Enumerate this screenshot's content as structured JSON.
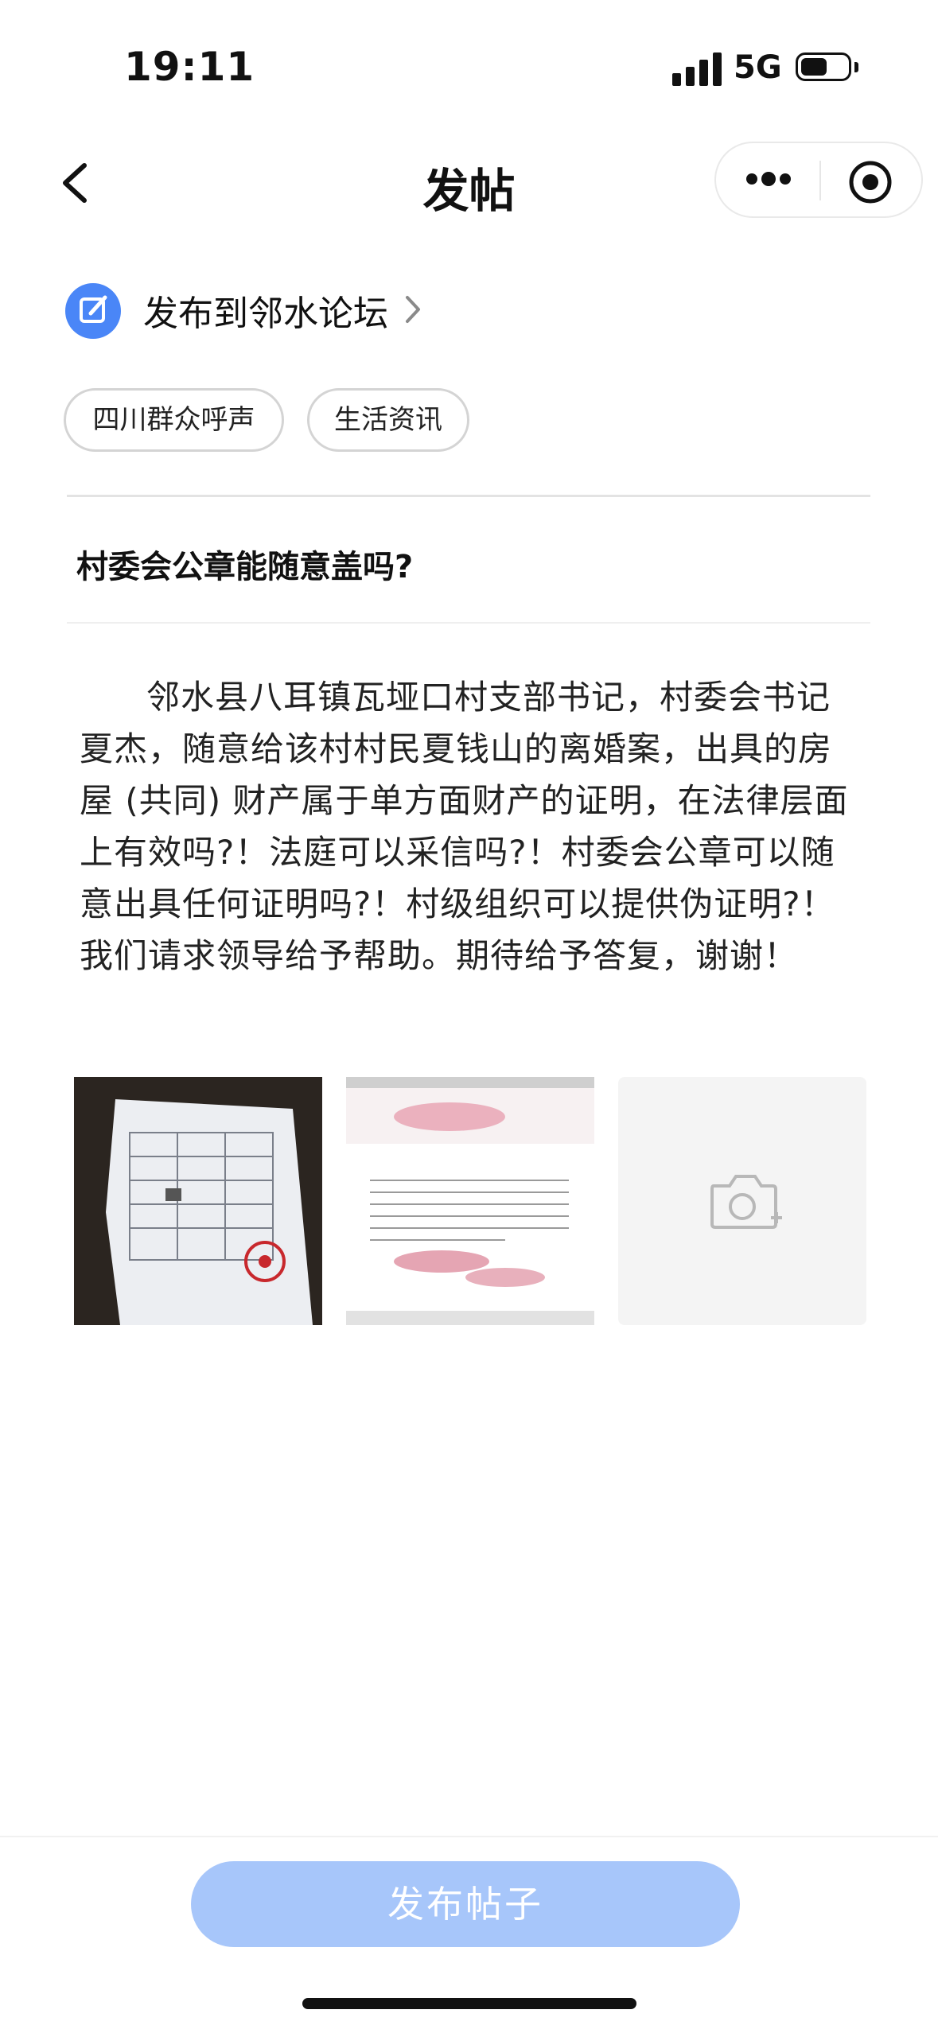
{
  "status_bar": {
    "time": "19:11",
    "network": "5G"
  },
  "nav": {
    "title": "发帖"
  },
  "forum": {
    "label": "发布到邻水论坛"
  },
  "tags": [
    "四川群众呼声",
    "生活资讯"
  ],
  "post": {
    "title": "村委会公章能随意盖吗?",
    "body": "邻水县八耳镇瓦垭口村支部书记，村委会书记夏杰，随意给该村村民夏钱山的离婚案，出具的房屋 (共同) 财产属于单方面财产的证明，在法律层面上有效吗?！法庭可以采信吗?！村委会公章可以随意出具任何证明吗?！村级组织可以提供伪证明?！我们请求领导给予帮助。期待给予答复，谢谢！"
  },
  "publish": {
    "label": "发布帖子"
  },
  "colors": {
    "accent": "#4a86f7",
    "button_disabled": "#a7c6fa"
  }
}
